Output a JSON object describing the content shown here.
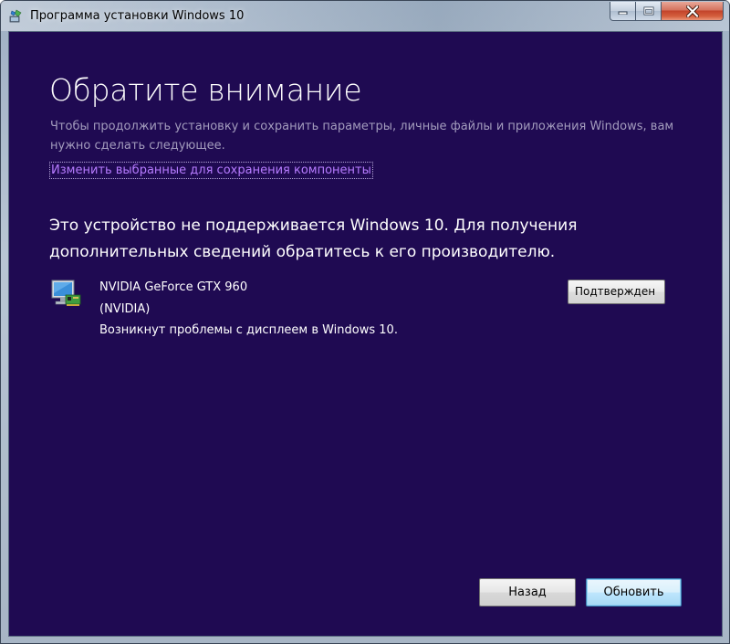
{
  "window": {
    "title": "Программа установки Windows 10"
  },
  "main": {
    "heading": "Обратите внимание",
    "subtext": "Чтобы продолжить установку и сохранить параметры, личные файлы и приложения Windows, вам нужно сделать следующее.",
    "change_link": "Изменить выбранные для сохранения компоненты",
    "warning": "Это устройство не поддерживается Windows 10. Для получения дополнительных сведений обратитесь к его производителю."
  },
  "device": {
    "name": "NVIDIA GeForce GTX 960",
    "vendor": "(NVIDIA)",
    "issue": "Возникнут проблемы с дисплеем в Windows 10.",
    "confirm_label": "Подтвержден",
    "icon": "monitor-device-icon"
  },
  "buttons": {
    "back": "Назад",
    "update": "Обновить"
  },
  "colors": {
    "background": "#1f0a52",
    "link": "#b77cff",
    "subtext": "#a39cbd"
  }
}
